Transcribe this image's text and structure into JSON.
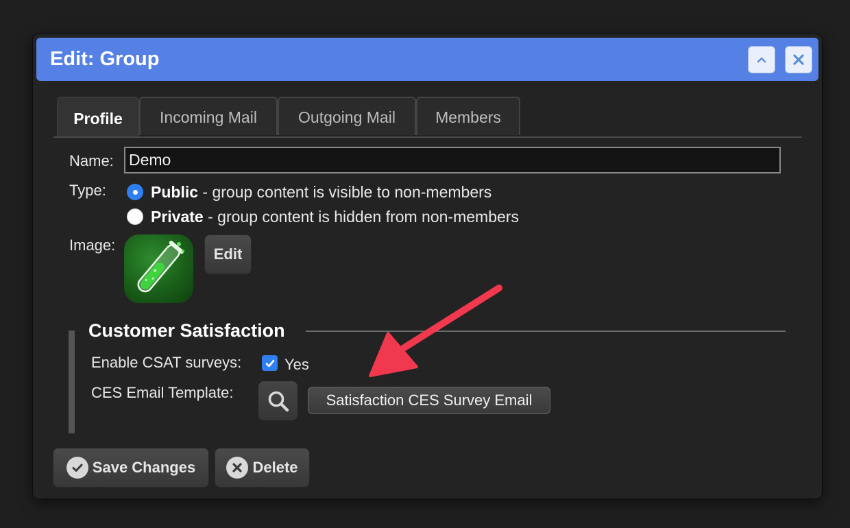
{
  "dialog": {
    "title": "Edit: Group"
  },
  "tabs": [
    {
      "label": "Profile",
      "active": true
    },
    {
      "label": "Incoming Mail",
      "active": false
    },
    {
      "label": "Outgoing Mail",
      "active": false
    },
    {
      "label": "Members",
      "active": false
    }
  ],
  "profile": {
    "name_label": "Name:",
    "name_value": "Demo",
    "type_label": "Type:",
    "type_options": [
      {
        "title": "Public",
        "desc": " - group content is visible to non-members",
        "selected": true
      },
      {
        "title": "Private",
        "desc": " - group content is hidden from non-members",
        "selected": false
      }
    ],
    "image_label": "Image:",
    "image_edit_label": "Edit"
  },
  "csat": {
    "legend": "Customer Satisfaction",
    "enable_label": "Enable CSAT surveys:",
    "enable_value": "Yes",
    "enabled": true,
    "ces_label": "CES Email Template:",
    "ces_template": "Satisfaction CES Survey Email"
  },
  "footer": {
    "save_label": "Save Changes",
    "delete_label": "Delete"
  },
  "colors": {
    "titlebar": "#5580e4",
    "accent": "#2f7ff3",
    "annotation_arrow": "#f0384f"
  }
}
